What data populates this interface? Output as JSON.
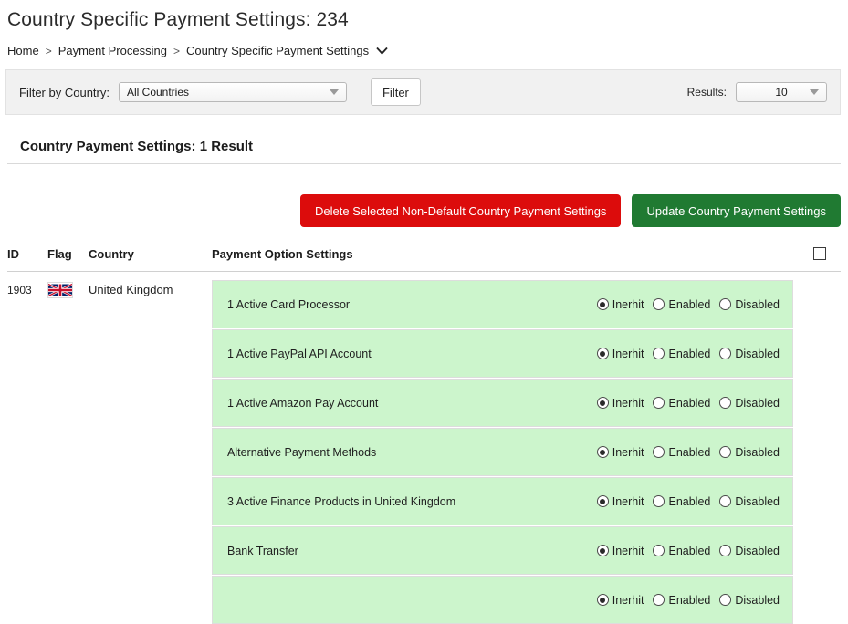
{
  "page": {
    "title": "Country Specific Payment Settings: 234"
  },
  "breadcrumb": {
    "items": [
      "Home",
      "Payment Processing",
      "Country Specific Payment Settings"
    ],
    "separator": ">",
    "chevron_icon": "chevron-down-icon"
  },
  "filter": {
    "label": "Filter by Country:",
    "country_value": "All Countries",
    "country_placeholder": "All Countries",
    "filter_button": "Filter",
    "results_label": "Results:",
    "results_value": "10",
    "arrow_icon": "triangle-down-icon"
  },
  "section": {
    "heading": "Country Payment Settings: 1 Result"
  },
  "actions": {
    "delete_label": "Delete Selected Non-Default Country Payment Settings",
    "update_label": "Update Country Payment Settings",
    "delete_color": "#dc0c0c",
    "update_color": "#207a32"
  },
  "table": {
    "columns": {
      "id": "ID",
      "flag": "Flag",
      "country": "Country",
      "options": "Payment Option Settings"
    },
    "select_all_checked": false,
    "row": {
      "id": "1903",
      "country": "United Kingdom",
      "flag_icon": "united-kingdom-flag-icon"
    },
    "radio_labels": {
      "inherit": "Inerhit",
      "enabled": "Enabled",
      "disabled": "Disabled"
    },
    "row_background": "#ccf5cc",
    "options": [
      {
        "label": "1 Active Card Processor",
        "selected": "inherit"
      },
      {
        "label": "1 Active PayPal API Account",
        "selected": "inherit"
      },
      {
        "label": "1 Active Amazon Pay Account",
        "selected": "inherit"
      },
      {
        "label": "Alternative Payment Methods",
        "selected": "inherit"
      },
      {
        "label": "3 Active Finance Products in United Kingdom",
        "selected": "inherit"
      },
      {
        "label": "Bank Transfer",
        "selected": "inherit"
      },
      {
        "label": "",
        "selected": "inherit"
      }
    ]
  }
}
